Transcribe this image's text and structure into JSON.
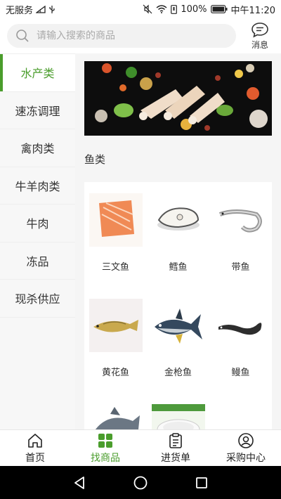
{
  "status": {
    "carrier": "无服务",
    "battery": "100%",
    "time": "中午11:20"
  },
  "search": {
    "placeholder": "请输入搜索的商品"
  },
  "message_label": "消息",
  "sidebar": {
    "items": [
      {
        "label": "水产类",
        "active": true
      },
      {
        "label": "速冻调理"
      },
      {
        "label": "禽肉类"
      },
      {
        "label": "牛羊肉类"
      },
      {
        "label": "牛肉"
      },
      {
        "label": "冻品"
      },
      {
        "label": "现杀供应"
      }
    ]
  },
  "section": {
    "title": "鱼类"
  },
  "products": [
    {
      "name": "三文鱼",
      "icon": "salmon-image"
    },
    {
      "name": "鳕鱼",
      "icon": "cod-image"
    },
    {
      "name": "带鱼",
      "icon": "hairtail-image"
    },
    {
      "name": "黄花鱼",
      "icon": "yellow-croaker-image"
    },
    {
      "name": "金枪鱼",
      "icon": "tuna-image"
    },
    {
      "name": "鳗鱼",
      "icon": "eel-image"
    },
    {
      "name": "",
      "icon": "fish-image"
    },
    {
      "name": "",
      "icon": "bowl-image"
    }
  ],
  "bottom_nav": [
    {
      "label": "首页",
      "icon": "home-icon"
    },
    {
      "label": "找商品",
      "icon": "grid-icon",
      "active": true
    },
    {
      "label": "进货单",
      "icon": "clipboard-icon"
    },
    {
      "label": "采购中心",
      "icon": "user-icon"
    }
  ],
  "colors": {
    "accent": "#4a9d2c"
  }
}
